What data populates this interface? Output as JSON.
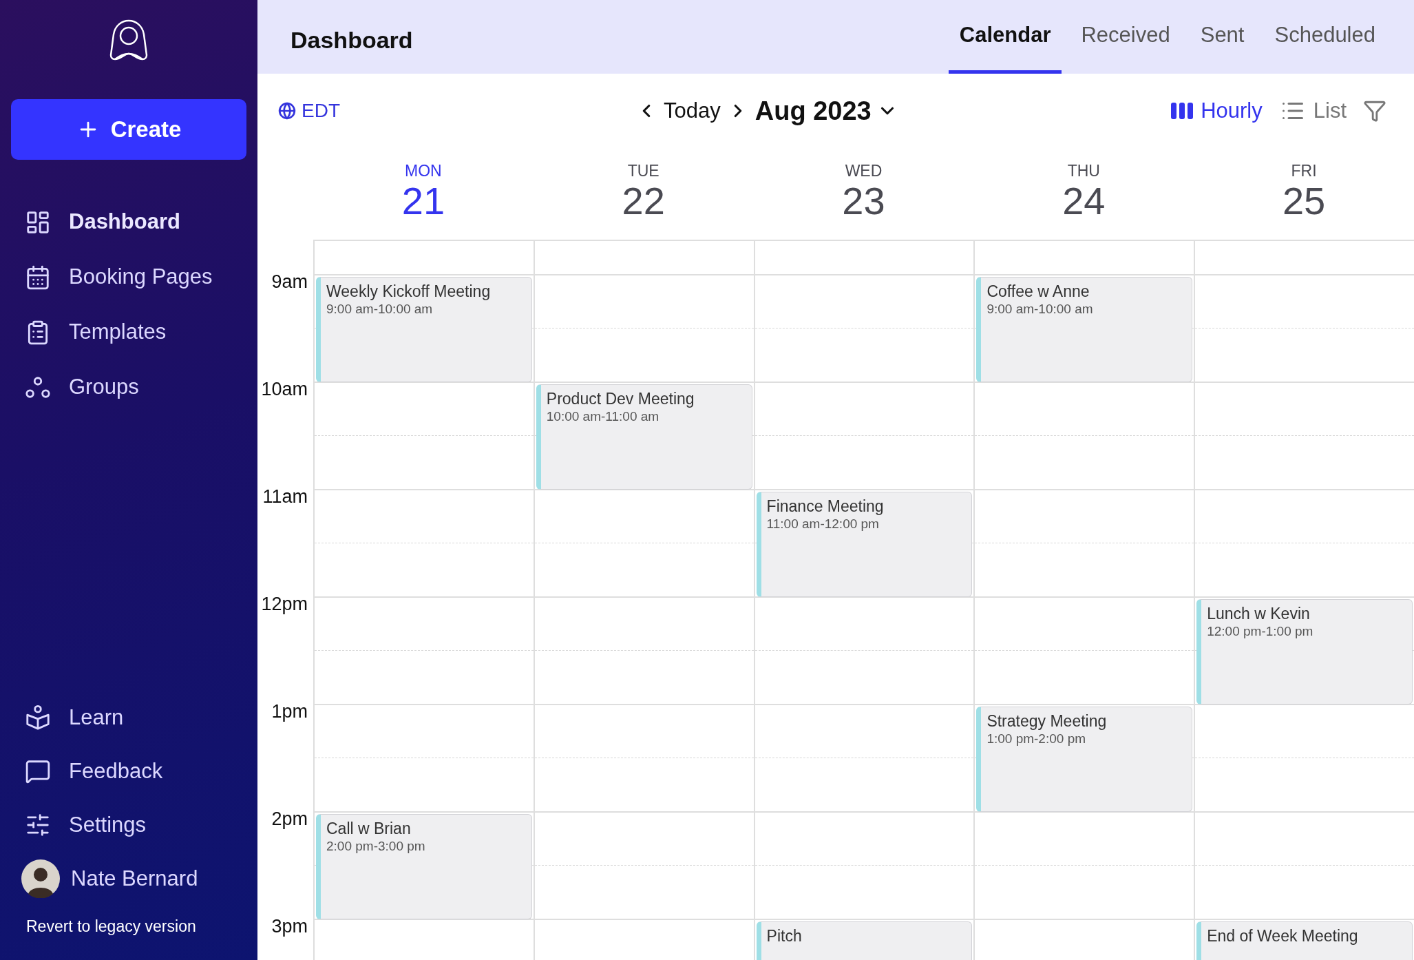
{
  "sidebar": {
    "create_button": {
      "label": "Create"
    },
    "nav_items": [
      {
        "label": "Dashboard",
        "kind": "dashboard",
        "selected": true
      },
      {
        "label": "Booking Pages",
        "kind": "calendar",
        "selected": false
      },
      {
        "label": "Templates",
        "kind": "clipboard",
        "selected": false
      },
      {
        "label": "Groups",
        "kind": "groups",
        "selected": false
      }
    ],
    "bottom_items": [
      {
        "label": "Learn",
        "kind": "learn"
      },
      {
        "label": "Feedback",
        "kind": "feedback"
      },
      {
        "label": "Settings",
        "kind": "settings"
      }
    ],
    "user": {
      "name": "Nate Bernard"
    },
    "legacy_link": "Revert to legacy version"
  },
  "header": {
    "title": "Dashboard",
    "tabs": [
      {
        "label": "Calendar",
        "selected": true
      },
      {
        "label": "Received",
        "selected": false
      },
      {
        "label": "Sent",
        "selected": false
      },
      {
        "label": "Scheduled",
        "selected": false
      }
    ]
  },
  "toolbar": {
    "timezone": "EDT",
    "today": "Today",
    "month": "Aug 2023",
    "views": [
      {
        "label": "Hourly",
        "kind": "hourly",
        "selected": true
      },
      {
        "label": "List",
        "kind": "list",
        "selected": false
      }
    ]
  },
  "days": [
    {
      "name": "MON",
      "date": "21",
      "selected": true
    },
    {
      "name": "TUE",
      "date": "22",
      "selected": false
    },
    {
      "name": "WED",
      "date": "23",
      "selected": false
    },
    {
      "name": "THU",
      "date": "24",
      "selected": false
    },
    {
      "name": "FRI",
      "date": "25",
      "selected": false
    }
  ],
  "hours": [
    {
      "label": "9am",
      "cells": [
        {
          "title": "Weekly Kickoff Meeting",
          "time": "9:00 am-10:00 am"
        },
        null,
        null,
        {
          "title": "Coffee w Anne",
          "time": "9:00 am-10:00 am"
        },
        null
      ]
    },
    {
      "label": "10am",
      "cells": [
        null,
        {
          "title": "Product Dev Meeting",
          "time": "10:00 am-11:00 am"
        },
        null,
        null,
        null
      ]
    },
    {
      "label": "11am",
      "cells": [
        null,
        null,
        {
          "title": "Finance Meeting",
          "time": "11:00 am-12:00 pm"
        },
        null,
        null
      ]
    },
    {
      "label": "12pm",
      "cells": [
        null,
        null,
        null,
        null,
        {
          "title": "Lunch w Kevin",
          "time": "12:00 pm-1:00 pm"
        }
      ]
    },
    {
      "label": "1pm",
      "cells": [
        null,
        null,
        null,
        {
          "title": "Strategy Meeting",
          "time": "1:00 pm-2:00 pm"
        },
        null
      ]
    },
    {
      "label": "2pm",
      "cells": [
        {
          "title": "Call w Brian",
          "time": "2:00 pm-3:00 pm"
        },
        null,
        null,
        null,
        null
      ]
    },
    {
      "label": "3pm",
      "cells": [
        null,
        null,
        {
          "title": "Pitch"
        },
        null,
        {
          "title": "End of Week Meeting"
        }
      ]
    }
  ]
}
